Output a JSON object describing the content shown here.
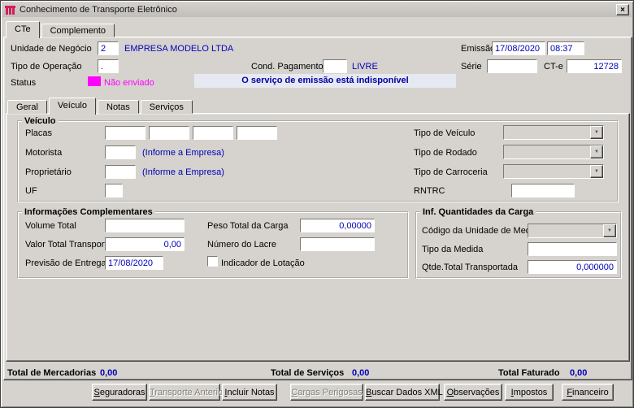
{
  "window": {
    "title": "Conhecimento de Transporte Eletrônico",
    "close_glyph": "×"
  },
  "outer_tabs": {
    "cte": "CTe",
    "complemento": "Complemento"
  },
  "header": {
    "unidade_label": "Unidade de Negócio",
    "unidade_value": "2",
    "empresa": "EMPRESA MODELO LTDA",
    "emissao_label": "Emissão",
    "emissao_date": "17/08/2020",
    "emissao_time": "08:37",
    "tipo_operacao_label": "Tipo de Operação",
    "tipo_operacao_value": ".",
    "cond_pagamento_label": "Cond. Pagamento",
    "cond_pagamento_desc": "LIVRE",
    "serie_label": "Série",
    "cte_label": "CT-e",
    "cte_value": "12728",
    "status_label": "Status",
    "status_value": "Não enviado",
    "service_message": "O serviço de emissão está indisponível"
  },
  "inner_tabs": {
    "geral": "Geral",
    "veiculo": "Veículo",
    "notas": "Notas",
    "servicos": "Serviços"
  },
  "veiculo": {
    "title": "Veículo",
    "placas_label": "Placas",
    "motorista_label": "Motorista",
    "motorista_hint": "(Informe a Empresa)",
    "proprietario_label": "Proprietário",
    "proprietario_hint": "(Informe a Empresa)",
    "uf_label": "UF",
    "tipo_veiculo_label": "Tipo de Veículo",
    "tipo_rodado_label": "Tipo de Rodado",
    "tipo_carroceria_label": "Tipo de Carroceria",
    "rntrc_label": "RNTRC"
  },
  "info_comp": {
    "title": "Informações Complementares",
    "volume_total_label": "Volume Total",
    "peso_total_label": "Peso Total da Carga",
    "peso_total_value": "0,00000",
    "valor_total_label": "Valor Total Transportado",
    "valor_total_value": "0,00",
    "numero_lacre_label": "Número do Lacre",
    "previsao_label": "Previsão de Entrega",
    "previsao_value": "17/08/2020",
    "indicador_lotacao_label": "Indicador de Lotação"
  },
  "quantidades": {
    "title": "Inf. Quantidades da Carga",
    "codigo_label": "Código da Unidade de Medida",
    "tipo_medida_label": "Tipo da Medida",
    "qtde_label": "Qtde.Total Transportada",
    "qtde_value": "0,000000"
  },
  "totals": [
    {
      "label": "Total de Mercadorias",
      "value": "0,00"
    },
    {
      "label": "Total de Serviços",
      "value": "0,00"
    },
    {
      "label": "Total Faturado",
      "value": "0,00"
    }
  ],
  "buttons": [
    {
      "label": "Seguradoras",
      "enabled": true
    },
    {
      "label": "Transporte Anterior",
      "enabled": false
    },
    {
      "label": "Incluir Notas",
      "enabled": true
    },
    {
      "label": "Cargas Perigosas",
      "enabled": false
    },
    {
      "label": "Buscar Dados XML",
      "enabled": true
    },
    {
      "label": "Observações",
      "enabled": true
    },
    {
      "label": "Impostos",
      "enabled": true
    },
    {
      "label": "Financeiro",
      "enabled": true
    }
  ],
  "colors": {
    "window_bg": "#d6d3ce",
    "value_blue": "#0000b8",
    "status_magenta": "#ff00ff",
    "message_navy": "#0000a0",
    "message_bg": "#e6e9f2"
  }
}
